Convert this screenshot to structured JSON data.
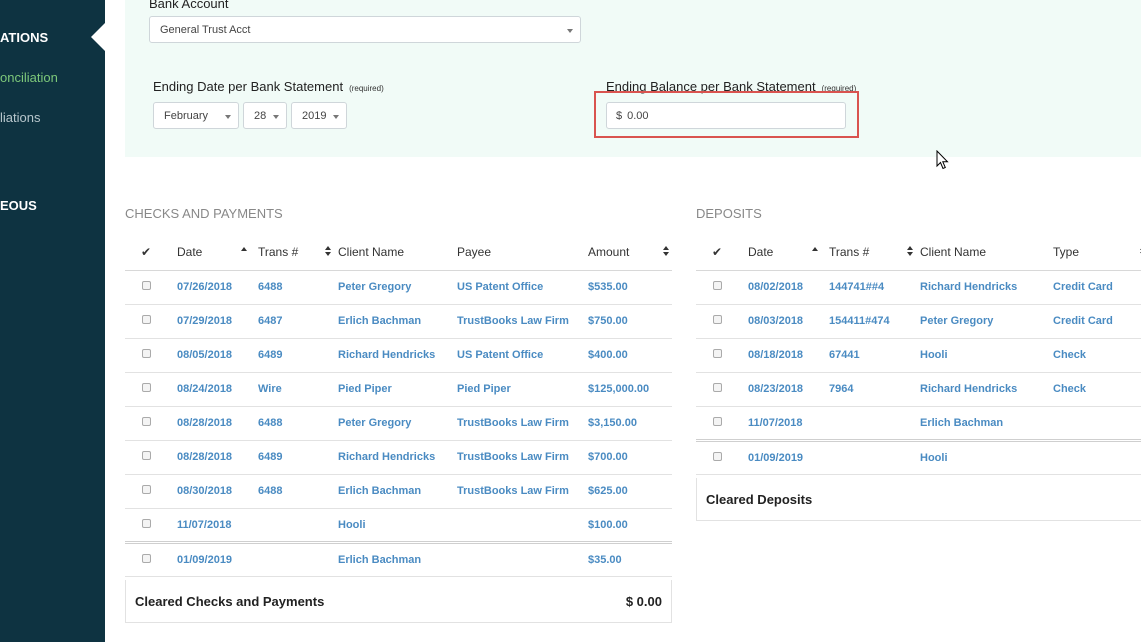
{
  "sidebar": {
    "items": [
      {
        "label": "ATIONS",
        "kind": "head"
      },
      {
        "label": "onciliation",
        "kind": "active"
      },
      {
        "label": "liations",
        "kind": "normal"
      },
      {
        "label": "EOUS",
        "kind": "head"
      }
    ]
  },
  "form": {
    "bank_account_label": "Bank Account",
    "bank_account_value": "General Trust Acct",
    "ending_date_label": "Ending Date per Bank Statement",
    "ending_date_required": "(required)",
    "month": "February",
    "day": "28",
    "year": "2019",
    "ending_balance_label": "Ending Balance per Bank Statement",
    "ending_balance_required": "(required)",
    "currency_symbol": "$",
    "ending_balance_placeholder": "0.00"
  },
  "checks": {
    "title": "CHECKS AND PAYMENTS",
    "headers": {
      "date": "Date",
      "trans": "Trans #",
      "client": "Client Name",
      "payee": "Payee",
      "amount": "Amount"
    },
    "rows": [
      {
        "date": "07/26/2018",
        "trans": "6488",
        "client": "Peter Gregory",
        "payee": "US Patent Office",
        "amount": "$535.00"
      },
      {
        "date": "07/29/2018",
        "trans": "6487",
        "client": "Erlich Bachman",
        "payee": "TrustBooks Law Firm",
        "amount": "$750.00"
      },
      {
        "date": "08/05/2018",
        "trans": "6489",
        "client": "Richard Hendricks",
        "payee": "US Patent Office",
        "amount": "$400.00"
      },
      {
        "date": "08/24/2018",
        "trans": "Wire",
        "client": "Pied Piper",
        "payee": "Pied Piper",
        "amount": "$125,000.00"
      },
      {
        "date": "08/28/2018",
        "trans": "6488",
        "client": "Peter Gregory",
        "payee": "TrustBooks Law Firm",
        "amount": "$3,150.00"
      },
      {
        "date": "08/28/2018",
        "trans": "6489",
        "client": "Richard Hendricks",
        "payee": "TrustBooks Law Firm",
        "amount": "$700.00"
      },
      {
        "date": "08/30/2018",
        "trans": "6488",
        "client": "Erlich Bachman",
        "payee": "TrustBooks Law Firm",
        "amount": "$625.00"
      },
      {
        "date": "11/07/2018",
        "trans": "",
        "client": "Hooli",
        "payee": "",
        "amount": "$100.00"
      },
      {
        "date": "01/09/2019",
        "trans": "",
        "client": "Erlich Bachman",
        "payee": "",
        "amount": "$35.00"
      }
    ],
    "footer_label": "Cleared Checks and Payments",
    "footer_amount": "$ 0.00"
  },
  "deposits": {
    "title": "DEPOSITS",
    "headers": {
      "date": "Date",
      "trans": "Trans #",
      "client": "Client Name",
      "type": "Type"
    },
    "rows": [
      {
        "date": "08/02/2018",
        "trans": "144741##4",
        "client": "Richard Hendricks",
        "type": "Credit Card"
      },
      {
        "date": "08/03/2018",
        "trans": "154411#474",
        "client": "Peter Gregory",
        "type": "Credit Card"
      },
      {
        "date": "08/18/2018",
        "trans": "67441",
        "client": "Hooli",
        "type": "Check"
      },
      {
        "date": "08/23/2018",
        "trans": "7964",
        "client": "Richard Hendricks",
        "type": "Check"
      },
      {
        "date": "11/07/2018",
        "trans": "",
        "client": "Erlich Bachman",
        "type": ""
      },
      {
        "date": "01/09/2019",
        "trans": "",
        "client": "Hooli",
        "type": ""
      }
    ],
    "footer_label": "Cleared Deposits"
  },
  "colors": {
    "sidebar": "#0e3341",
    "link": "#4a8bc2",
    "panel": "#f1fbf7",
    "highlight": "#d9534f"
  }
}
